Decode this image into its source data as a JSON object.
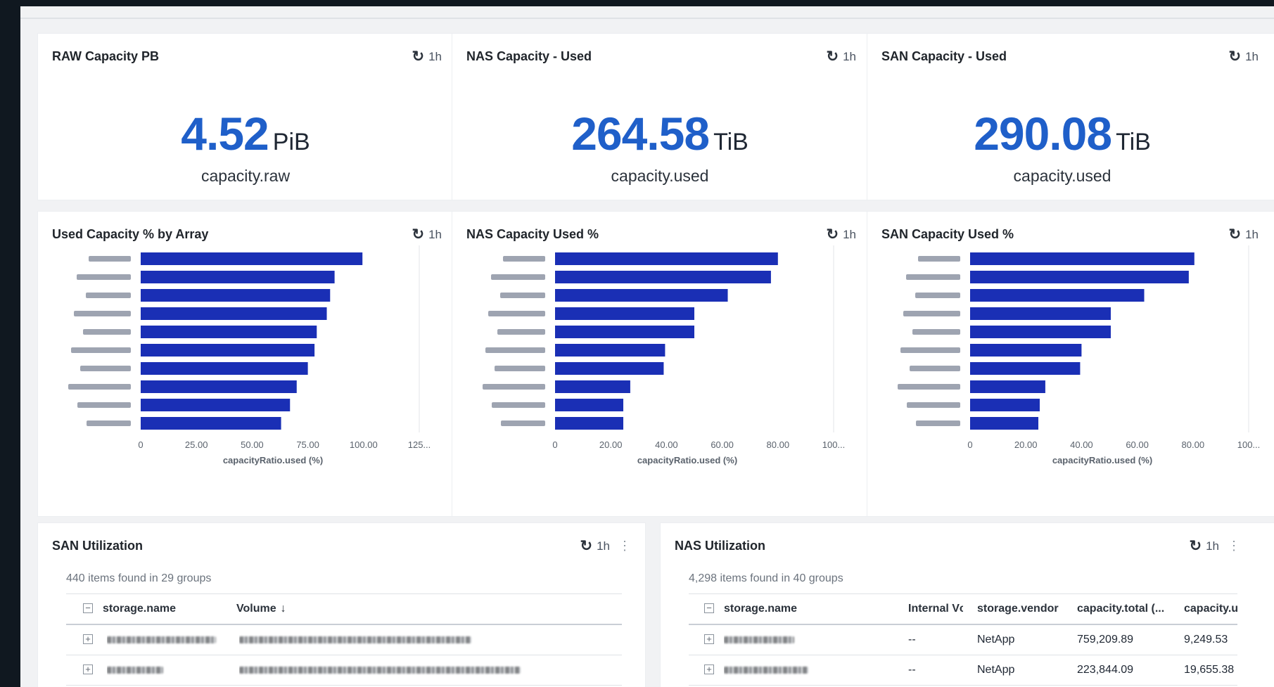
{
  "kpis": [
    {
      "title": "RAW Capacity PB",
      "refresh": "1h",
      "value": "4.52",
      "unit": "PiB",
      "metric": "capacity.raw"
    },
    {
      "title": "NAS Capacity - Used",
      "refresh": "1h",
      "value": "264.58",
      "unit": "TiB",
      "metric": "capacity.used"
    },
    {
      "title": "SAN Capacity - Used",
      "refresh": "1h",
      "value": "290.08",
      "unit": "TiB",
      "metric": "capacity.used"
    }
  ],
  "chart_cards": [
    {
      "title": "Used Capacity % by Array",
      "refresh": "1h"
    },
    {
      "title": "NAS Capacity Used %",
      "refresh": "1h"
    },
    {
      "title": "SAN Capacity Used %",
      "refresh": "1h"
    }
  ],
  "chart_data": [
    {
      "type": "bar",
      "orientation": "horizontal",
      "title": "Used Capacity % by Array",
      "xlabel": "capacityRatio.used (%)",
      "xlim": [
        0,
        125
      ],
      "x_ticks": [
        "0",
        "25.00",
        "50.00",
        "75.00",
        "100.00",
        "125..."
      ],
      "category_labels_blurred": true,
      "values": [
        99.5,
        87,
        85,
        83.5,
        79,
        78,
        75,
        70,
        67,
        63
      ],
      "bar_color": "#1a2fb5"
    },
    {
      "type": "bar",
      "orientation": "horizontal",
      "title": "NAS Capacity Used %",
      "xlabel": "capacityRatio.used (%)",
      "xlim": [
        0,
        100
      ],
      "x_ticks": [
        "0",
        "20.00",
        "40.00",
        "60.00",
        "80.00",
        "100..."
      ],
      "category_labels_blurred": true,
      "values": [
        80,
        77.5,
        62,
        50,
        50,
        39.5,
        39,
        27,
        24.5,
        24.5
      ],
      "bar_color": "#1a2fb5"
    },
    {
      "type": "bar",
      "orientation": "horizontal",
      "title": "SAN Capacity Used %",
      "xlabel": "capacityRatio.used (%)",
      "xlim": [
        0,
        100
      ],
      "x_ticks": [
        "0",
        "20.00",
        "40.00",
        "60.00",
        "80.00",
        "100..."
      ],
      "category_labels_blurred": true,
      "values": [
        80.5,
        78.5,
        62.5,
        50.5,
        50.5,
        40,
        39.5,
        27,
        25,
        24.5
      ],
      "bar_color": "#1a2fb5"
    }
  ],
  "san_table": {
    "title": "SAN Utilization",
    "refresh": "1h",
    "count": "440 items found in 29 groups",
    "columns": [
      "storage.name",
      "Volume"
    ],
    "rows": [
      {},
      {}
    ]
  },
  "nas_table": {
    "title": "NAS Utilization",
    "refresh": "1h",
    "count": "4,298 items found in 40 groups",
    "columns": [
      "storage.name",
      "Internal Vc",
      "storage.vendor",
      "capacity.total (...",
      "capacity.u"
    ],
    "rows": [
      {
        "internal": "--",
        "vendor": "NetApp",
        "total": "759,209.89",
        "used": "9,249.53"
      },
      {
        "internal": "--",
        "vendor": "NetApp",
        "total": "223,844.09",
        "used": "19,655.38"
      }
    ]
  }
}
